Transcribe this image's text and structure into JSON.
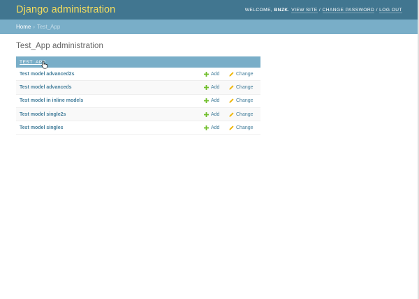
{
  "header": {
    "title": "Django administration",
    "welcome_label": "WELCOME,",
    "username": "BNZK",
    "view_site": "VIEW SITE",
    "change_password": "CHANGE PASSWORD",
    "log_out": "LOG OUT",
    "separator": "/"
  },
  "breadcrumbs": {
    "home": "Home",
    "separator": "›",
    "current": "Test_App"
  },
  "page_title": "Test_App administration",
  "module": {
    "caption": "TEST_APP",
    "rows": [
      {
        "name": "Test model advanced2s",
        "add_label": "Add",
        "change_label": "Change"
      },
      {
        "name": "Test model advanceds",
        "add_label": "Add",
        "change_label": "Change"
      },
      {
        "name": "Test model in inline models",
        "add_label": "Add",
        "change_label": "Change"
      },
      {
        "name": "Test model single2s",
        "add_label": "Add",
        "change_label": "Change"
      },
      {
        "name": "Test model singles",
        "add_label": "Add",
        "change_label": "Change"
      }
    ]
  },
  "icons": {
    "add": "plus-icon",
    "change": "pencil-icon",
    "cursor": "hand-pointer-icon"
  },
  "colors": {
    "header_bg": "#417690",
    "branding": "#f5dd5d",
    "breadcrumbs_bg": "#79aec8",
    "link": "#447e9b",
    "add_green": "#70bf2b",
    "change_yellow": "#efb80b"
  }
}
